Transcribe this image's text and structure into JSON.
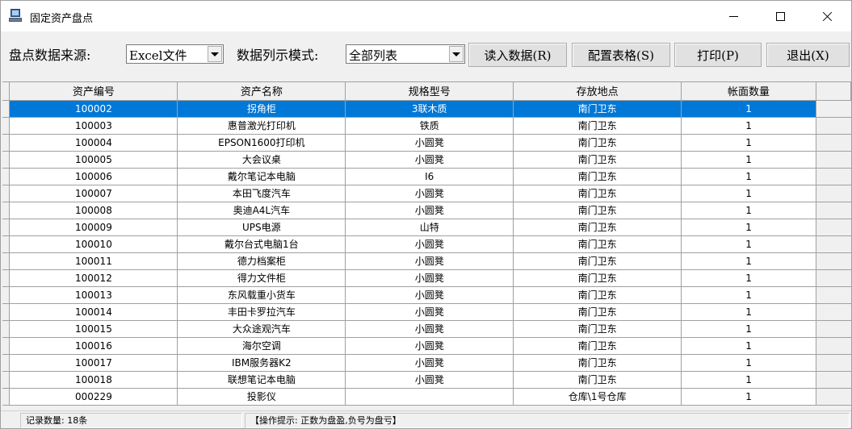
{
  "window": {
    "title": "固定资产盘点"
  },
  "toolbar": {
    "source_label": "盘点数据来源:",
    "source_value": "Excel文件",
    "mode_label": "数据列示模式:",
    "mode_value": "全部列表",
    "load_button": "读入数据(R)",
    "config_button": "配置表格(S)",
    "print_button": "打印(P)",
    "exit_button": "退出(X)"
  },
  "grid": {
    "columns": [
      "资产编号",
      "资产名称",
      "规格型号",
      "存放地点",
      "帐面数量"
    ],
    "selected_row": 0,
    "rows": [
      [
        "100002",
        "拐角柜",
        "3联木质",
        "南门卫东",
        "1"
      ],
      [
        "100003",
        "惠普激光打印机",
        "铁质",
        "南门卫东",
        "1"
      ],
      [
        "100004",
        "EPSON1600打印机",
        "小圆凳",
        "南门卫东",
        "1"
      ],
      [
        "100005",
        "大会议桌",
        "小圆凳",
        "南门卫东",
        "1"
      ],
      [
        "100006",
        "戴尔笔记本电脑",
        "I6",
        "南门卫东",
        "1"
      ],
      [
        "100007",
        "本田飞度汽车",
        "小圆凳",
        "南门卫东",
        "1"
      ],
      [
        "100008",
        "奥迪A4L汽车",
        "小圆凳",
        "南门卫东",
        "1"
      ],
      [
        "100009",
        "UPS电源",
        "山特",
        "南门卫东",
        "1"
      ],
      [
        "100010",
        "戴尔台式电脑1台",
        "小圆凳",
        "南门卫东",
        "1"
      ],
      [
        "100011",
        "德力档案柜",
        "小圆凳",
        "南门卫东",
        "1"
      ],
      [
        "100012",
        "得力文件柜",
        "小圆凳",
        "南门卫东",
        "1"
      ],
      [
        "100013",
        "东风载重小货车",
        "小圆凳",
        "南门卫东",
        "1"
      ],
      [
        "100014",
        "丰田卡罗拉汽车",
        "小圆凳",
        "南门卫东",
        "1"
      ],
      [
        "100015",
        "大众途观汽车",
        "小圆凳",
        "南门卫东",
        "1"
      ],
      [
        "100016",
        "海尔空调",
        "小圆凳",
        "南门卫东",
        "1"
      ],
      [
        "100017",
        "IBM服务器K2",
        "小圆凳",
        "南门卫东",
        "1"
      ],
      [
        "100018",
        "联想笔记本电脑",
        "小圆凳",
        "南门卫东",
        "1"
      ],
      [
        "000229",
        "投影仪",
        "",
        "仓库\\1号仓库",
        "1"
      ]
    ]
  },
  "statusbar": {
    "record_count": "记录数量: 18条",
    "hint": "【操作提示: 正数为盘盈,负号为盘亏】"
  },
  "colors": {
    "selection": "#0078d7",
    "chrome": "#f0f0f0"
  },
  "icons": [
    "app-icon",
    "minimize-icon",
    "maximize-icon",
    "close-icon",
    "dropdown-arrow-icon"
  ]
}
